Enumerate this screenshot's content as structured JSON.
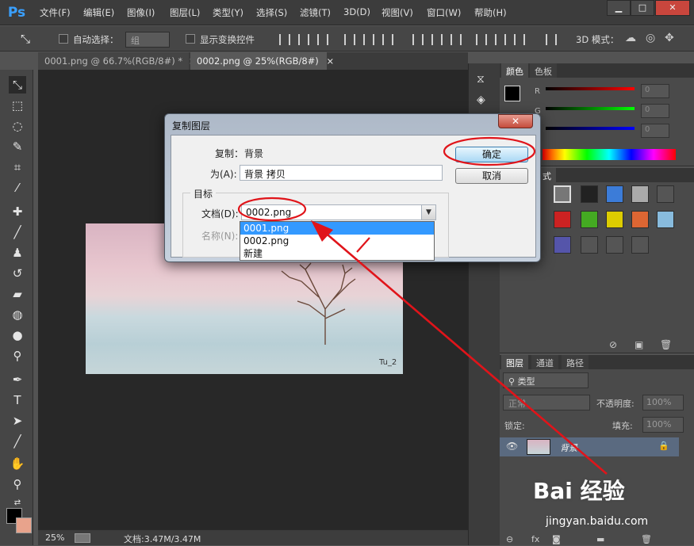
{
  "app": {
    "logo": "Ps"
  },
  "menu": [
    "文件(F)",
    "编辑(E)",
    "图像(I)",
    "图层(L)",
    "类型(Y)",
    "选择(S)",
    "滤镜(T)",
    "3D(D)",
    "视图(V)",
    "窗口(W)",
    "帮助(H)"
  ],
  "window_buttons": {
    "min": "▁",
    "max": "□",
    "close": "✕"
  },
  "options": {
    "auto_select": "自动选择：",
    "auto_select_value": "组",
    "show_transform": "显示变换控件",
    "mode_3d": "3D 模式："
  },
  "tabs": [
    {
      "label": "0001.png @ 66.7%(RGB/8#) *",
      "close": "×"
    },
    {
      "label": "0002.png @ 25%(RGB/8#)",
      "close": "×"
    }
  ],
  "canvas": {
    "watermark": "Tu_2"
  },
  "status": {
    "zoom": "25%",
    "doc_info": "文档:3.47M/3.47M"
  },
  "color_panel": {
    "tabs": [
      "颜色",
      "色板"
    ],
    "channels": [
      {
        "label": "R",
        "value": "0"
      },
      {
        "label": "G",
        "value": "0"
      },
      {
        "label": "B",
        "value": "0"
      }
    ],
    "fg_color": "#000000",
    "bg_color": "#e8a38c"
  },
  "styles_panel": {
    "tab_fragment": "式"
  },
  "layers_panel": {
    "tabs": [
      "图层",
      "通道",
      "路径"
    ],
    "filter_kind": "类型",
    "blend_mode": "正常",
    "opacity_label": "不透明度:",
    "opacity_value": "100%",
    "lock_label": "锁定:",
    "fill_label": "填充:",
    "fill_value": "100%",
    "layer_name": "背景"
  },
  "dialog": {
    "title": "复制图层",
    "close": "✕",
    "copy_label": "复制：",
    "copy_value": "背景",
    "as_label": "为(A):",
    "as_value": "背景 拷贝",
    "target_group": "目标",
    "document_label": "文档(D):",
    "document_value": "0002.png",
    "name_label": "名称(N):",
    "ok_label": "确定",
    "cancel_label": "取消",
    "dropdown_options": [
      "0001.png",
      "0002.png",
      "新建"
    ],
    "dropdown_selected": 0
  },
  "watermark": {
    "brand": "Bai 经验",
    "url": "jingyan.baidu.com"
  }
}
